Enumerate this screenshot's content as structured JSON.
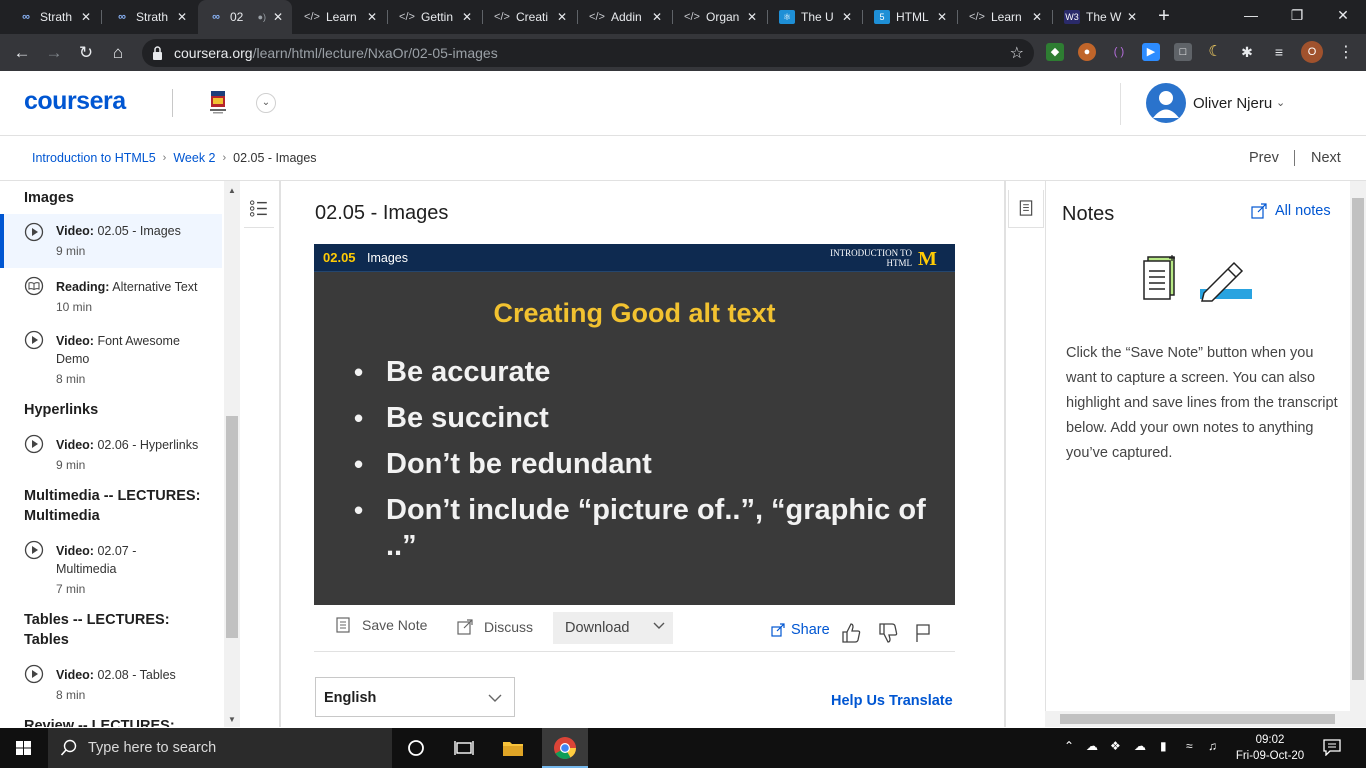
{
  "browser": {
    "tabs": [
      {
        "icon": "coursera-icon",
        "label": "Strath"
      },
      {
        "icon": "coursera-icon",
        "label": "Strath"
      },
      {
        "icon": "coursera-icon",
        "label": "02"
      },
      {
        "icon": "code-icon",
        "label": "Learn"
      },
      {
        "icon": "code-icon",
        "label": "Gettin"
      },
      {
        "icon": "code-icon",
        "label": "Creati"
      },
      {
        "icon": "code-icon",
        "label": "Addin"
      },
      {
        "icon": "code-icon",
        "label": "Organ"
      },
      {
        "icon": "react-icon",
        "label": "The U"
      },
      {
        "icon": "html5-icon",
        "label": "HTML"
      },
      {
        "icon": "code-icon",
        "label": "Learn"
      },
      {
        "icon": "w3schools-icon",
        "label": "The W"
      }
    ],
    "url_host": "coursera.org",
    "url_path": "/learn/html/lecture/NxaOr/02-05-images",
    "profile_initial": "O"
  },
  "header": {
    "logo": "coursera",
    "user_name": "Oliver Njeru"
  },
  "breadcrumb": {
    "items": [
      "Introduction to HTML5",
      "Week 2",
      "02.05 - Images"
    ],
    "prev": "Prev",
    "next": "Next"
  },
  "sidebar": {
    "sections": [
      {
        "title": "Images",
        "items": [
          {
            "type": "Video:",
            "name": "02.05 - Images",
            "duration": "9 min",
            "icon": "play-icon",
            "selected": true
          },
          {
            "type": "Reading:",
            "name": "Alternative Text",
            "duration": "10 min",
            "icon": "reading-icon"
          },
          {
            "type": "Video:",
            "name": "Font Awesome Demo",
            "duration": "8 min",
            "icon": "play-icon"
          }
        ]
      },
      {
        "title": "Hyperlinks",
        "items": [
          {
            "type": "Video:",
            "name": "02.06 - Hyperlinks",
            "duration": "9 min",
            "icon": "play-icon"
          }
        ]
      },
      {
        "title": "Multimedia -- LECTURES: Multimedia",
        "items": [
          {
            "type": "Video:",
            "name": "02.07 - Multimedia",
            "duration": "7 min",
            "icon": "play-icon"
          }
        ]
      },
      {
        "title": "Tables -- LECTURES: Tables",
        "items": [
          {
            "type": "Video:",
            "name": "02.08 - Tables",
            "duration": "8 min",
            "icon": "play-icon"
          }
        ]
      },
      {
        "title": "Review -- LECTURES:",
        "items": []
      }
    ]
  },
  "lecture": {
    "title": "02.05 - Images",
    "video": {
      "number": "02.05",
      "topic": "Images",
      "course_tag": "INTRODUCTION TO HTML",
      "brand_mark": "M",
      "slide_title": "Creating Good alt text",
      "bullets": [
        "Be accurate",
        "Be succinct",
        "Don’t be redundant",
        "Don’t include “picture of..”, “graphic of ..”"
      ]
    },
    "tools": {
      "save_note": "Save Note",
      "discuss": "Discuss",
      "download": "Download",
      "share": "Share"
    },
    "language": "English",
    "help_translate": "Help Us Translate"
  },
  "notes": {
    "title": "Notes",
    "all_notes": "All notes",
    "help_text": "Click the “Save Note” button when you want to capture a screen. You can also highlight and save lines from the transcript below. Add your own notes to anything you’ve captured."
  },
  "taskbar": {
    "search_placeholder": "Type here to search",
    "time": "09:02",
    "date": "Fri-09-Oct-20"
  },
  "colors": {
    "brand_blue": "#0056d2",
    "maize": "#ffcb05",
    "chrome_dark": "#202124"
  }
}
